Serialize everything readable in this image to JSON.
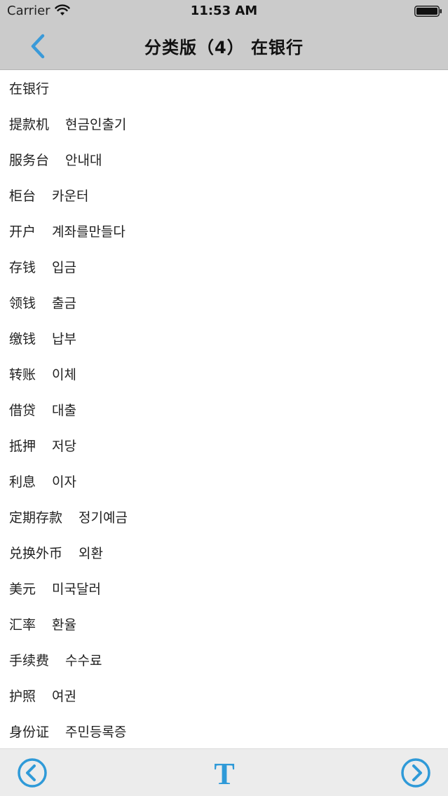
{
  "status_bar": {
    "carrier": "Carrier",
    "time": "11:53 AM",
    "wifi_icon": "wifi-icon",
    "battery_icon": "battery-icon"
  },
  "nav": {
    "title": "分类版（4） 在银行",
    "back_icon": "chevron-left-icon",
    "accent_color": "#3a9ad9"
  },
  "list": [
    {
      "zh": "在银行",
      "ko": ""
    },
    {
      "zh": "提款机",
      "ko": "현금인출기"
    },
    {
      "zh": "服务台",
      "ko": "안내대"
    },
    {
      "zh": "柜台",
      "ko": "카운터"
    },
    {
      "zh": "开户",
      "ko": "계좌를만들다"
    },
    {
      "zh": "存钱",
      "ko": "입금"
    },
    {
      "zh": "领钱",
      "ko": "출금"
    },
    {
      "zh": "缴钱",
      "ko": "납부"
    },
    {
      "zh": "转账",
      "ko": "이체"
    },
    {
      "zh": "借贷",
      "ko": "대출"
    },
    {
      "zh": "抵押",
      "ko": "저당"
    },
    {
      "zh": "利息",
      "ko": "이자"
    },
    {
      "zh": "定期存款",
      "ko": "정기예금"
    },
    {
      "zh": "兑换外币",
      "ko": "외환"
    },
    {
      "zh": "美元",
      "ko": "미국달러"
    },
    {
      "zh": "汇率",
      "ko": "환율"
    },
    {
      "zh": "手续费",
      "ko": "수수료"
    },
    {
      "zh": "护照",
      "ko": "여권"
    },
    {
      "zh": "身份证",
      "ko": "주민등록증"
    }
  ],
  "toolbar": {
    "prev_icon": "circle-chevron-left-icon",
    "font_icon": "text-size-icon",
    "font_glyph": "T",
    "next_icon": "circle-chevron-right-icon",
    "icon_color": "#2f9ad8"
  }
}
